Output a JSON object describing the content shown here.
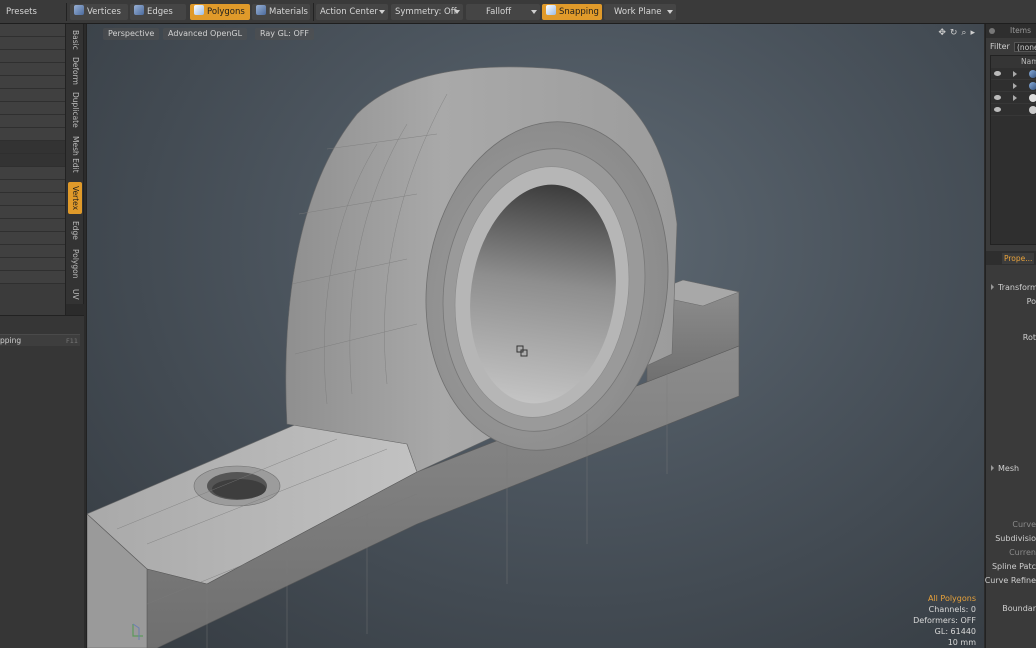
{
  "toolbar": {
    "presets": "Presets",
    "vertices": "Vertices",
    "edges": "Edges",
    "polygons": "Polygons",
    "materials": "Materials",
    "action_center": "Action Center",
    "symmetry": "Symmetry: Off",
    "falloff": "Falloff",
    "snapping": "Snapping",
    "work_plane": "Work Plane",
    "active_color": "#e09a2a"
  },
  "left_tabs": [
    "Basic",
    "Deform",
    "Duplicate",
    "Mesh Edit",
    "Vertex",
    "Edge",
    "Polygon",
    "UV"
  ],
  "left_active_tab": "Vertex",
  "left_lower": {
    "snapping_label": "pping",
    "shortcut": "F11"
  },
  "viewport": {
    "view_mode": "Perspective",
    "shading": "Advanced OpenGL",
    "ray_gl": "Ray GL: OFF",
    "icons": [
      "move-view-icon",
      "rotate-view-icon",
      "zoom-view-icon",
      "viewport-menu-icon"
    ]
  },
  "stats": {
    "selection": "All Polygons",
    "channels": "Channels: 0",
    "deformers": "Deformers: OFF",
    "gl": "GL: 61440",
    "units": "10 mm"
  },
  "items_panel": {
    "title": "Items",
    "filter_label": "Filter",
    "filter_value": "(none",
    "name_column": "Nam"
  },
  "properties_panel": {
    "tab": "Prope...",
    "transform_section": "Transform",
    "position": "Po",
    "rotation": "Rot",
    "mesh_section": "Mesh",
    "curve": "Curve",
    "subdivision": "Subdivisio",
    "current": "Curren",
    "spline_patch": "Spline Patc",
    "curve_refine": "Curve Refine",
    "boundary": "Boundar"
  }
}
